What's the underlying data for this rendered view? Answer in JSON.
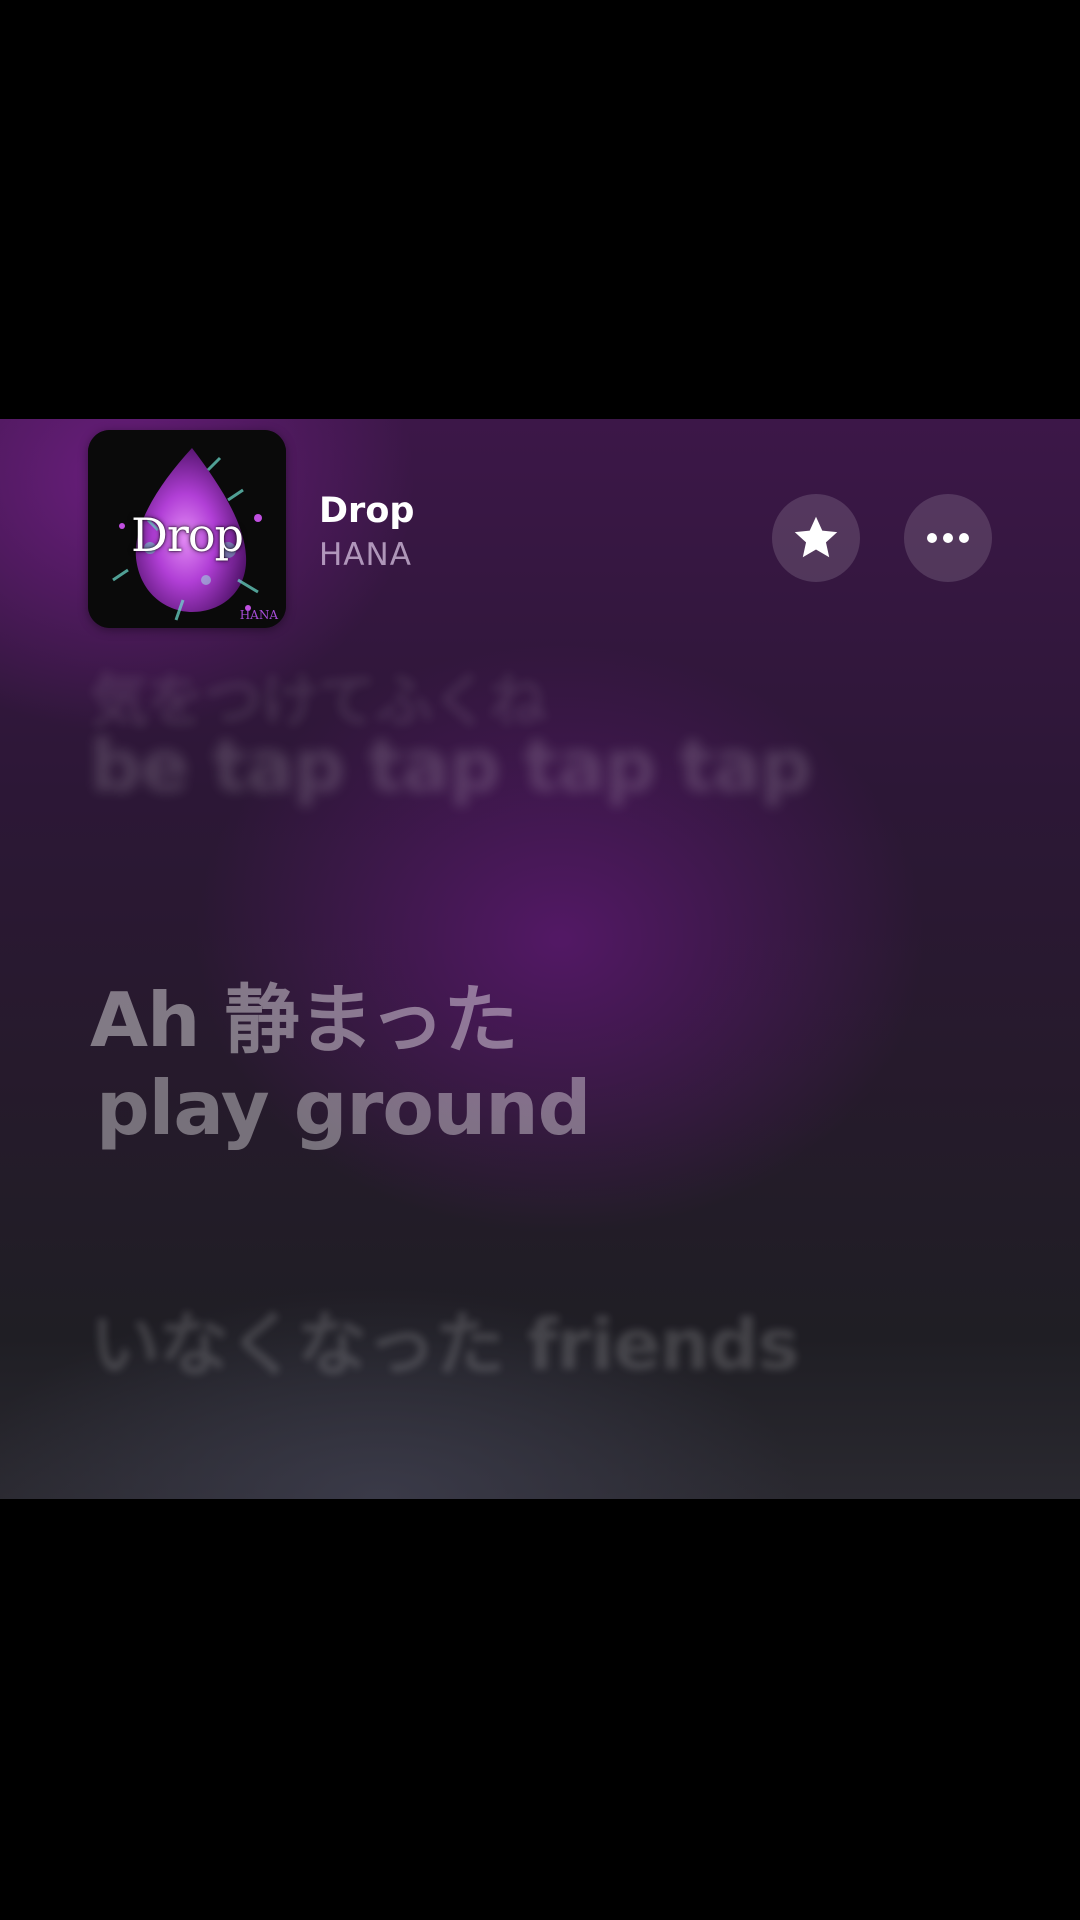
{
  "now_playing": {
    "cover": {
      "title_text": "Drop",
      "logo_text": "HANA"
    },
    "title": "Drop",
    "artist": "HANA"
  },
  "actions": {
    "favorite_icon": "star-icon",
    "more_icon": "ellipsis-icon"
  },
  "lyrics": {
    "previous_line_1": "気をつけてふくね",
    "previous_line_2": "be tap tap tap tap",
    "current_line_1": "Ah 静まった",
    "current_line_2": "play ground",
    "next_line_1": "いなくなった friends"
  },
  "colors": {
    "accent_purple": "#5a186e",
    "background_dark": "#000000",
    "cover_drop": "#c04fe0"
  }
}
